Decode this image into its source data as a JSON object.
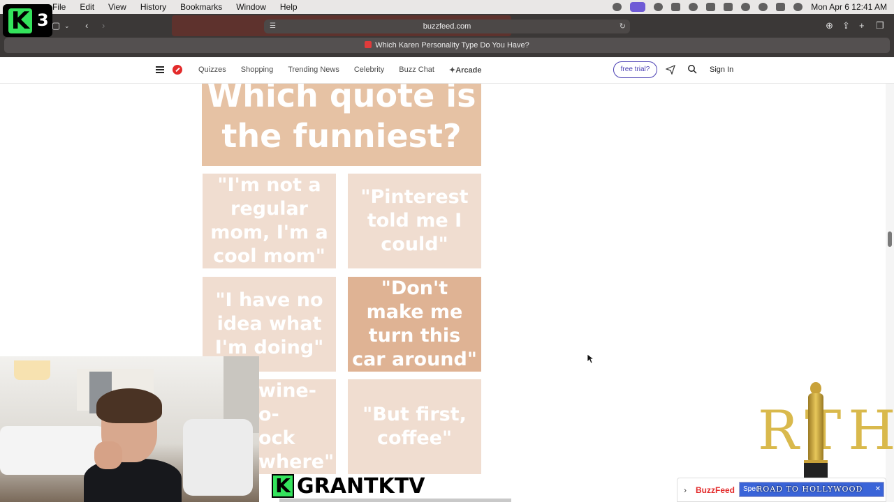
{
  "menubar": {
    "items": [
      "File",
      "Edit",
      "View",
      "History",
      "Bookmarks",
      "Window",
      "Help"
    ],
    "datetime": "Mon Apr 6  12:41 AM"
  },
  "browser": {
    "url": "buzzfeed.com",
    "tab_title": "Which Karen Personality Type Do You Have?"
  },
  "site_nav": {
    "links": [
      "Quizzes",
      "Shopping",
      "Trending News",
      "Celebrity",
      "Buzz Chat"
    ],
    "arcade": "Arcade",
    "trial": "free trial?",
    "sign_in": "Sign In"
  },
  "quiz": {
    "question": "Which quote is the funniest?",
    "answers": [
      "\"I'm not a regular mom, I'm a cool mom\"",
      "\"Pinterest told me I could\"",
      "\"I have no idea what I'm doing\"",
      "\"Don't make me turn this car around\"",
      "wine-o-\nock\nwhere\"",
      "\"But first, coffee\""
    ],
    "selected_index": 3,
    "colors": {
      "title_bg": "#e6c2a4",
      "answer_bg": "#f0ddd0",
      "selected_bg": "#dfb394"
    }
  },
  "overlays": {
    "channel_badge_number": "3",
    "channel_logo_letter": "K",
    "channel_name": "GRANTKTV",
    "rth_letters": "RTH",
    "bottom_bar_brand": "BuzzFeed",
    "bottom_bar_ad_prefix": "Spec",
    "bottom_bar_ad_text": "ROAD TO HOLLYWOOD"
  }
}
